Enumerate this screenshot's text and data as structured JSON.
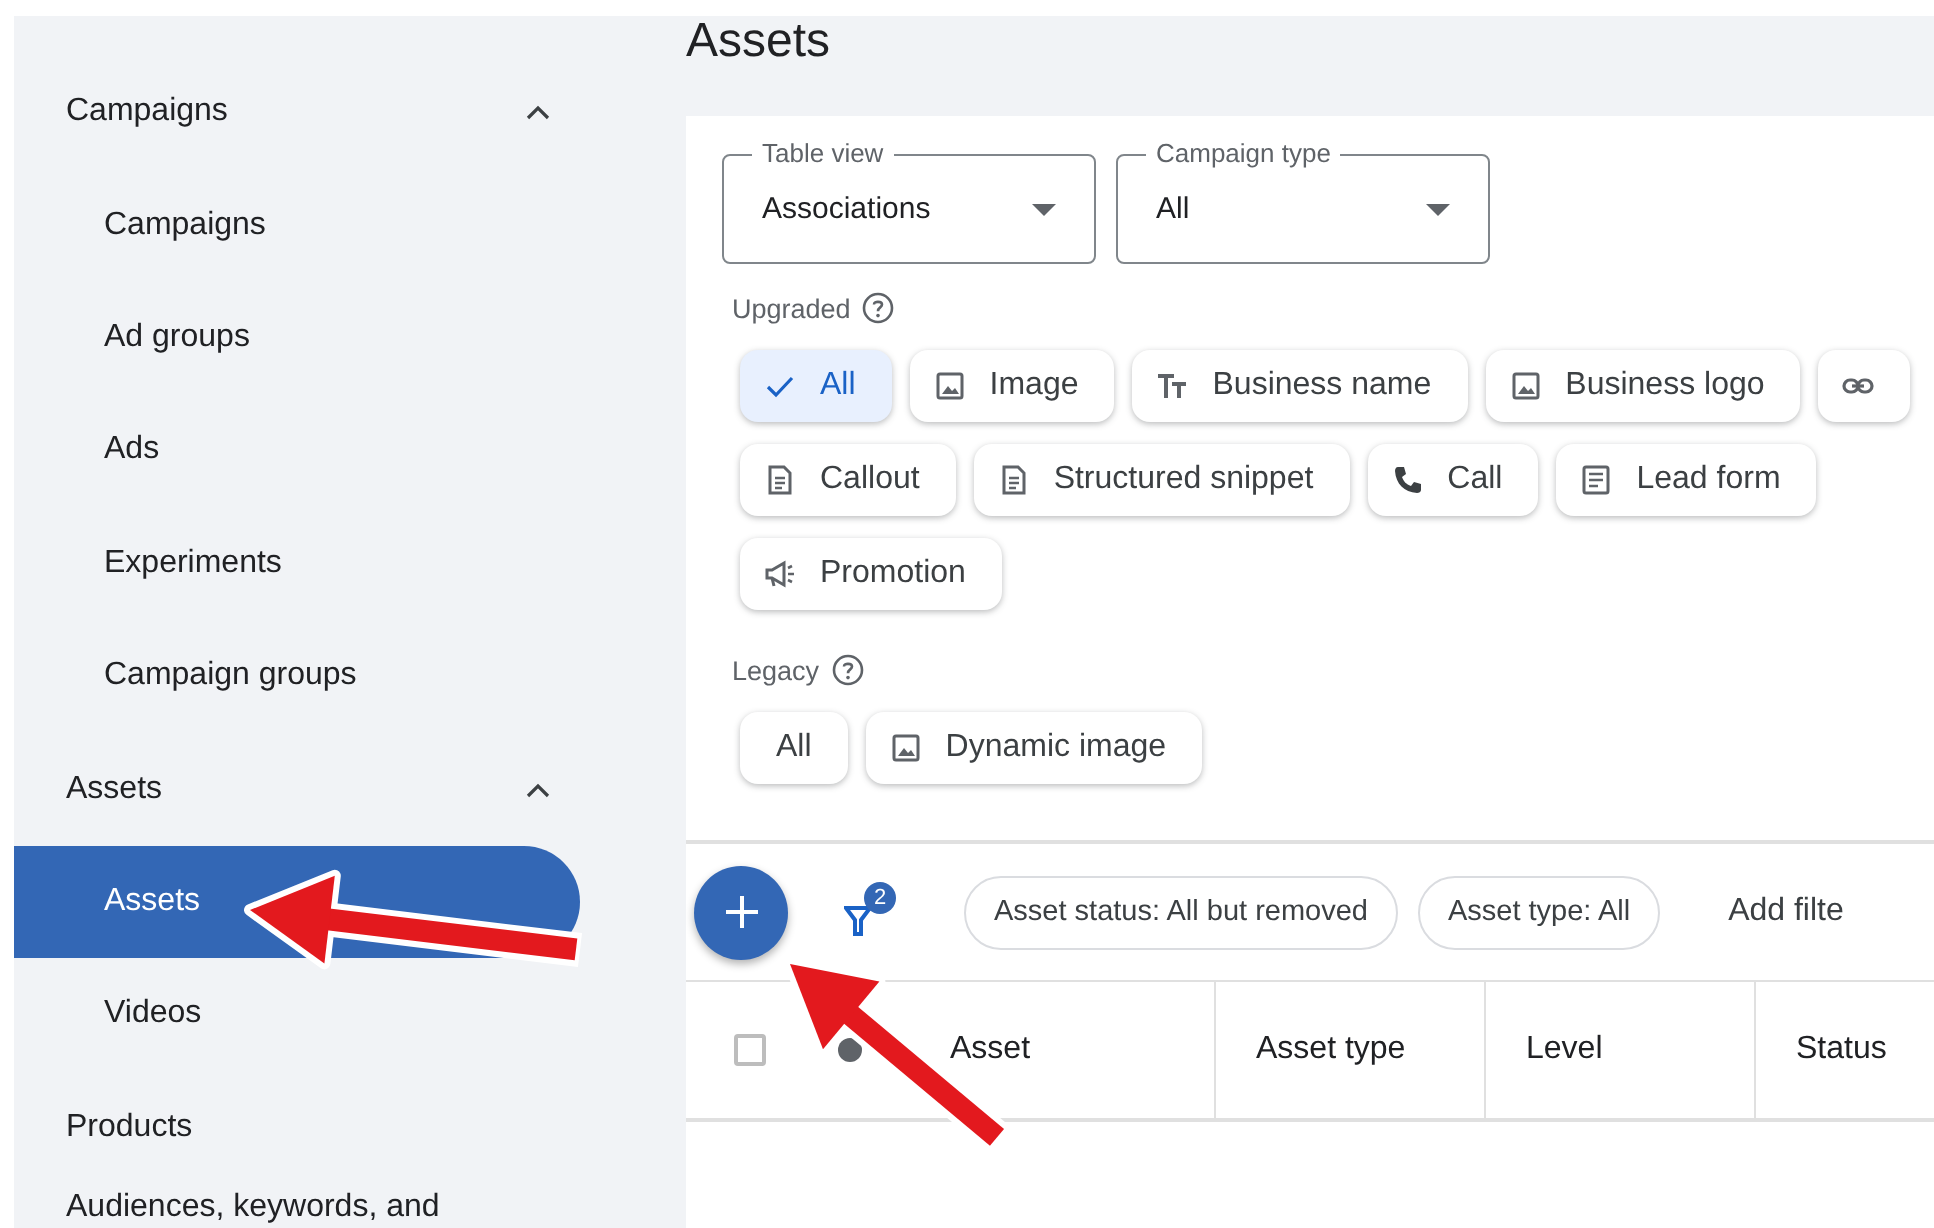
{
  "sidebar": {
    "items": [
      {
        "label": "Campaigns",
        "kind": "group",
        "expanded": true,
        "children": [
          {
            "label": "Campaigns",
            "selected": false
          },
          {
            "label": "Ad groups",
            "selected": false
          },
          {
            "label": "Ads",
            "selected": false
          },
          {
            "label": "Experiments",
            "selected": false
          },
          {
            "label": "Campaign groups",
            "selected": false
          }
        ]
      },
      {
        "label": "Assets",
        "kind": "group",
        "expanded": true,
        "children": [
          {
            "label": "Assets",
            "selected": true
          },
          {
            "label": "Videos",
            "selected": false
          }
        ]
      },
      {
        "label": "Products",
        "kind": "link"
      },
      {
        "label": "Audiences, keywords, and",
        "kind": "link"
      }
    ]
  },
  "page_title": "Assets",
  "dropdowns": [
    {
      "label": "Table view",
      "value": "Associations"
    },
    {
      "label": "Campaign type",
      "value": "All"
    }
  ],
  "upgraded": {
    "label": "Upgraded",
    "chip_rows": [
      [
        {
          "label": "All",
          "selected": true
        },
        {
          "label": "Image",
          "kind": "image",
          "selected": false
        },
        {
          "label": "Business name",
          "kind": "text",
          "selected": false
        },
        {
          "label": "Business logo",
          "kind": "image",
          "selected": false
        },
        {
          "kind": "link",
          "selected": false
        }
      ],
      [
        {
          "label": "Callout",
          "kind": "doc",
          "selected": false
        },
        {
          "label": "Structured snippet",
          "kind": "doc",
          "selected": false
        },
        {
          "label": "Call",
          "kind": "call",
          "selected": false
        },
        {
          "label": "Lead form",
          "kind": "form",
          "selected": false
        }
      ],
      [
        {
          "label": "Promotion",
          "kind": "megaphone",
          "selected": false
        }
      ]
    ]
  },
  "legacy": {
    "label": "Legacy",
    "chips": [
      {
        "label": "All",
        "selected": false
      },
      {
        "label": "Dynamic image",
        "kind": "image",
        "selected": false
      }
    ]
  },
  "toolbar": {
    "filter_count": "2",
    "pills": [
      "Asset status: All but removed",
      "Asset type: All"
    ],
    "add_filter": "Add filte"
  },
  "table": {
    "select_all_checked": false,
    "columns": [
      "Asset",
      "Asset type",
      "Level",
      "Status"
    ]
  }
}
